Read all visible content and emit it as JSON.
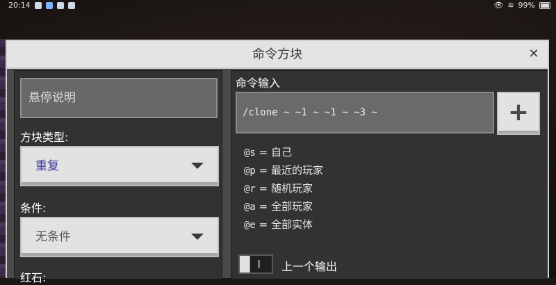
{
  "status_bar": {
    "time": "20:14",
    "battery": "99%"
  },
  "dialog": {
    "title": "命令方块",
    "close_symbol": "✕"
  },
  "left": {
    "hover_note_placeholder": "悬停说明",
    "block_type_label": "方块类型:",
    "block_type_value": "重复",
    "block_type_color": "#3b3b9a",
    "condition_label": "条件:",
    "condition_value": "无条件",
    "condition_color": "#555555",
    "redstone_label": "红石:"
  },
  "right": {
    "command_label": "命令输入",
    "command_value": "/clone ~ ~1 ~ ~1 ~ ~3 ~",
    "add_button": "+",
    "selectors": [
      {
        "code": "@s",
        "desc": "自己"
      },
      {
        "code": "@p",
        "desc": "最近的玩家"
      },
      {
        "code": "@r",
        "desc": "随机玩家"
      },
      {
        "code": "@a",
        "desc": "全部玩家"
      },
      {
        "code": "@e",
        "desc": "全部实体"
      }
    ],
    "previous_output_label": "上一个输出"
  }
}
